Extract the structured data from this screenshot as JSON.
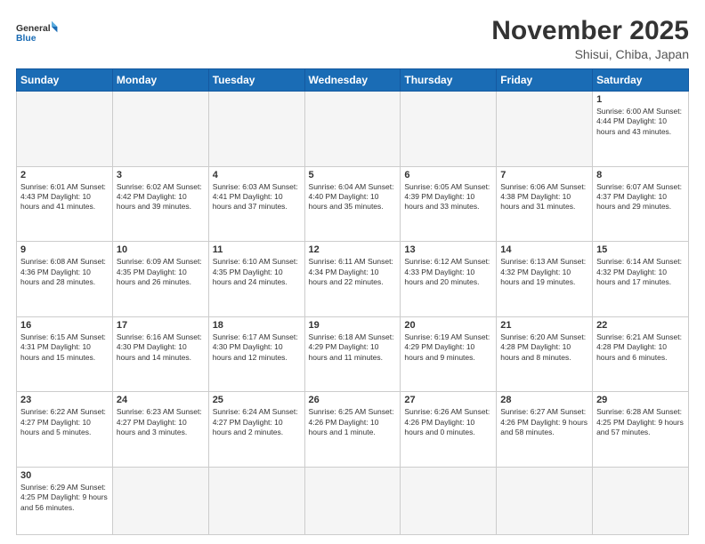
{
  "header": {
    "logo_general": "General",
    "logo_blue": "Blue",
    "month": "November 2025",
    "location": "Shisui, Chiba, Japan"
  },
  "days_of_week": [
    "Sunday",
    "Monday",
    "Tuesday",
    "Wednesday",
    "Thursday",
    "Friday",
    "Saturday"
  ],
  "weeks": [
    [
      {
        "day": "",
        "info": ""
      },
      {
        "day": "",
        "info": ""
      },
      {
        "day": "",
        "info": ""
      },
      {
        "day": "",
        "info": ""
      },
      {
        "day": "",
        "info": ""
      },
      {
        "day": "",
        "info": ""
      },
      {
        "day": "1",
        "info": "Sunrise: 6:00 AM\nSunset: 4:44 PM\nDaylight: 10 hours\nand 43 minutes."
      }
    ],
    [
      {
        "day": "2",
        "info": "Sunrise: 6:01 AM\nSunset: 4:43 PM\nDaylight: 10 hours\nand 41 minutes."
      },
      {
        "day": "3",
        "info": "Sunrise: 6:02 AM\nSunset: 4:42 PM\nDaylight: 10 hours\nand 39 minutes."
      },
      {
        "day": "4",
        "info": "Sunrise: 6:03 AM\nSunset: 4:41 PM\nDaylight: 10 hours\nand 37 minutes."
      },
      {
        "day": "5",
        "info": "Sunrise: 6:04 AM\nSunset: 4:40 PM\nDaylight: 10 hours\nand 35 minutes."
      },
      {
        "day": "6",
        "info": "Sunrise: 6:05 AM\nSunset: 4:39 PM\nDaylight: 10 hours\nand 33 minutes."
      },
      {
        "day": "7",
        "info": "Sunrise: 6:06 AM\nSunset: 4:38 PM\nDaylight: 10 hours\nand 31 minutes."
      },
      {
        "day": "8",
        "info": "Sunrise: 6:07 AM\nSunset: 4:37 PM\nDaylight: 10 hours\nand 29 minutes."
      }
    ],
    [
      {
        "day": "9",
        "info": "Sunrise: 6:08 AM\nSunset: 4:36 PM\nDaylight: 10 hours\nand 28 minutes."
      },
      {
        "day": "10",
        "info": "Sunrise: 6:09 AM\nSunset: 4:35 PM\nDaylight: 10 hours\nand 26 minutes."
      },
      {
        "day": "11",
        "info": "Sunrise: 6:10 AM\nSunset: 4:35 PM\nDaylight: 10 hours\nand 24 minutes."
      },
      {
        "day": "12",
        "info": "Sunrise: 6:11 AM\nSunset: 4:34 PM\nDaylight: 10 hours\nand 22 minutes."
      },
      {
        "day": "13",
        "info": "Sunrise: 6:12 AM\nSunset: 4:33 PM\nDaylight: 10 hours\nand 20 minutes."
      },
      {
        "day": "14",
        "info": "Sunrise: 6:13 AM\nSunset: 4:32 PM\nDaylight: 10 hours\nand 19 minutes."
      },
      {
        "day": "15",
        "info": "Sunrise: 6:14 AM\nSunset: 4:32 PM\nDaylight: 10 hours\nand 17 minutes."
      }
    ],
    [
      {
        "day": "16",
        "info": "Sunrise: 6:15 AM\nSunset: 4:31 PM\nDaylight: 10 hours\nand 15 minutes."
      },
      {
        "day": "17",
        "info": "Sunrise: 6:16 AM\nSunset: 4:30 PM\nDaylight: 10 hours\nand 14 minutes."
      },
      {
        "day": "18",
        "info": "Sunrise: 6:17 AM\nSunset: 4:30 PM\nDaylight: 10 hours\nand 12 minutes."
      },
      {
        "day": "19",
        "info": "Sunrise: 6:18 AM\nSunset: 4:29 PM\nDaylight: 10 hours\nand 11 minutes."
      },
      {
        "day": "20",
        "info": "Sunrise: 6:19 AM\nSunset: 4:29 PM\nDaylight: 10 hours\nand 9 minutes."
      },
      {
        "day": "21",
        "info": "Sunrise: 6:20 AM\nSunset: 4:28 PM\nDaylight: 10 hours\nand 8 minutes."
      },
      {
        "day": "22",
        "info": "Sunrise: 6:21 AM\nSunset: 4:28 PM\nDaylight: 10 hours\nand 6 minutes."
      }
    ],
    [
      {
        "day": "23",
        "info": "Sunrise: 6:22 AM\nSunset: 4:27 PM\nDaylight: 10 hours\nand 5 minutes."
      },
      {
        "day": "24",
        "info": "Sunrise: 6:23 AM\nSunset: 4:27 PM\nDaylight: 10 hours\nand 3 minutes."
      },
      {
        "day": "25",
        "info": "Sunrise: 6:24 AM\nSunset: 4:27 PM\nDaylight: 10 hours\nand 2 minutes."
      },
      {
        "day": "26",
        "info": "Sunrise: 6:25 AM\nSunset: 4:26 PM\nDaylight: 10 hours\nand 1 minute."
      },
      {
        "day": "27",
        "info": "Sunrise: 6:26 AM\nSunset: 4:26 PM\nDaylight: 10 hours\nand 0 minutes."
      },
      {
        "day": "28",
        "info": "Sunrise: 6:27 AM\nSunset: 4:26 PM\nDaylight: 9 hours\nand 58 minutes."
      },
      {
        "day": "29",
        "info": "Sunrise: 6:28 AM\nSunset: 4:25 PM\nDaylight: 9 hours\nand 57 minutes."
      }
    ],
    [
      {
        "day": "30",
        "info": "Sunrise: 6:29 AM\nSunset: 4:25 PM\nDaylight: 9 hours\nand 56 minutes."
      },
      {
        "day": "",
        "info": ""
      },
      {
        "day": "",
        "info": ""
      },
      {
        "day": "",
        "info": ""
      },
      {
        "day": "",
        "info": ""
      },
      {
        "day": "",
        "info": ""
      },
      {
        "day": "",
        "info": ""
      }
    ]
  ]
}
